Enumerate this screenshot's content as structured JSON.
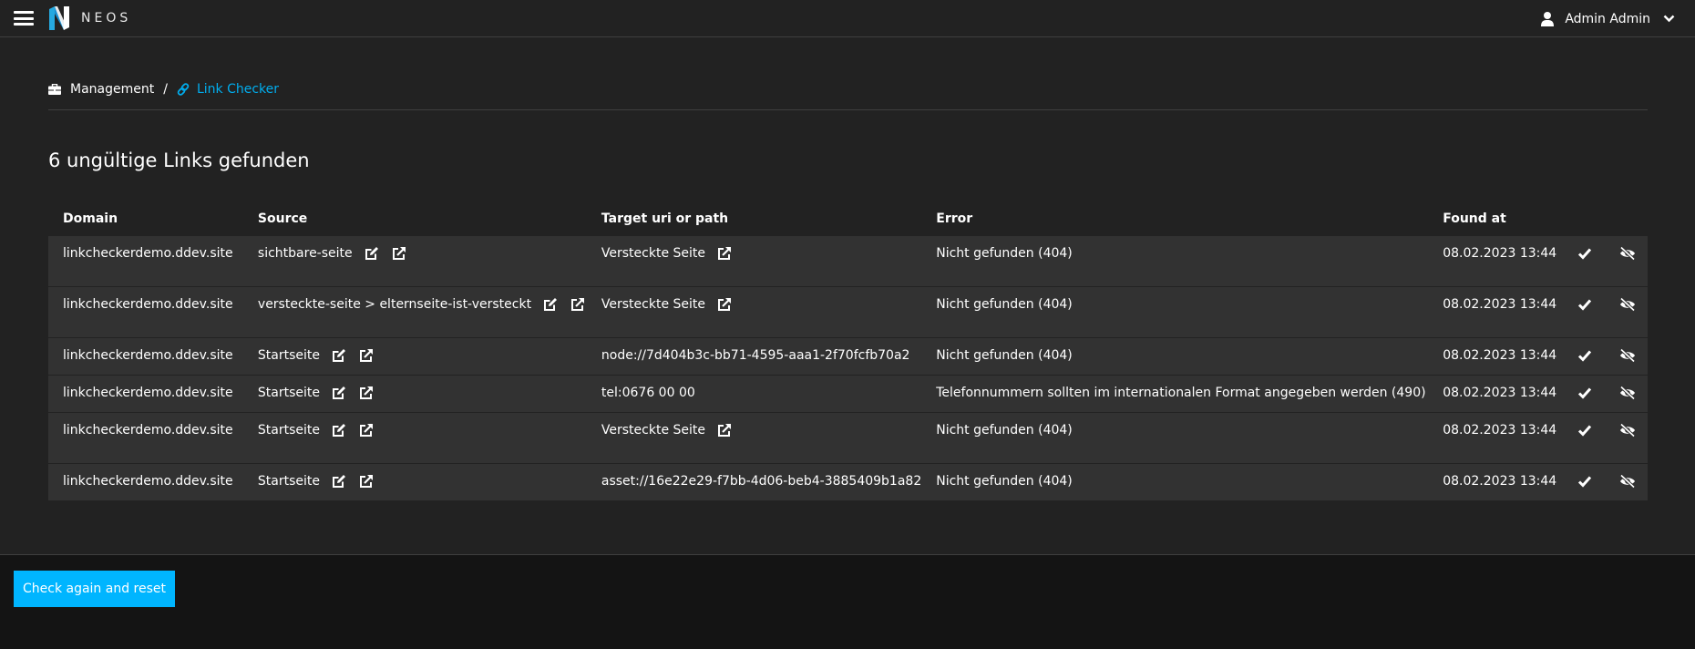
{
  "app": {
    "logo_text": "NEOS",
    "brand_color": "#00adee"
  },
  "header": {
    "user_name": "Admin Admin"
  },
  "breadcrumb": {
    "parent": "Management",
    "separator": "/",
    "current": "Link Checker"
  },
  "main": {
    "heading": "6 ungültige Links gefunden",
    "columns": [
      "Domain",
      "Source",
      "Target uri or path",
      "Error",
      "Found at"
    ],
    "rows": [
      {
        "domain": "linkcheckerdemo.ddev.site",
        "source": "sichtbare-seite",
        "target": "Versteckte Seite",
        "target_has_link": true,
        "error": "Nicht gefunden (404)",
        "found_at": "08.02.2023 13:44"
      },
      {
        "domain": "linkcheckerdemo.ddev.site",
        "source": "versteckte-seite > elternseite-ist-versteckt",
        "target": "Versteckte Seite",
        "target_has_link": true,
        "error": "Nicht gefunden (404)",
        "found_at": "08.02.2023 13:44"
      },
      {
        "domain": "linkcheckerdemo.ddev.site",
        "source": "Startseite",
        "target": "node://7d404b3c-bb71-4595-aaa1-2f70fcfb70a2",
        "target_has_link": false,
        "error": "Nicht gefunden (404)",
        "found_at": "08.02.2023 13:44"
      },
      {
        "domain": "linkcheckerdemo.ddev.site",
        "source": "Startseite",
        "target": "tel:0676 00 00",
        "target_has_link": false,
        "error": "Telefonnummern sollten im internationalen Format angegeben werden (490)",
        "found_at": "08.02.2023 13:44"
      },
      {
        "domain": "linkcheckerdemo.ddev.site",
        "source": "Startseite",
        "target": "Versteckte Seite",
        "target_has_link": true,
        "error": "Nicht gefunden (404)",
        "found_at": "08.02.2023 13:44"
      },
      {
        "domain": "linkcheckerdemo.ddev.site",
        "source": "Startseite",
        "target": "asset://16e22e29-f7bb-4d06-beb4-3885409b1a82",
        "target_has_link": false,
        "error": "Nicht gefunden (404)",
        "found_at": "08.02.2023 13:44"
      }
    ],
    "row_icons": {
      "edit": "edit-icon",
      "open": "external-link-icon",
      "mark_done": "check-icon",
      "ignore": "eye-slash-icon"
    }
  },
  "footer": {
    "primary_button": "Check again and reset",
    "button_color": "#00b5ff"
  }
}
